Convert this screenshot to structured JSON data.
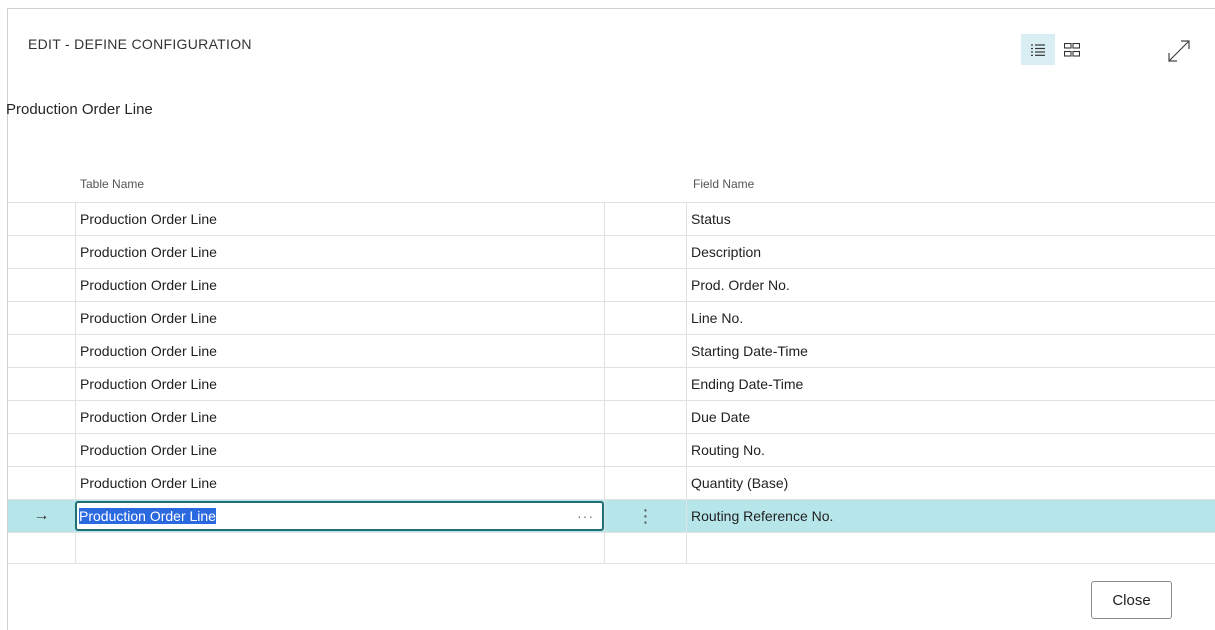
{
  "dialog": {
    "title": "EDIT - DEFINE CONFIGURATION",
    "subtitle": "Production Order Line",
    "close_label": "Close"
  },
  "toolbar": {
    "list_view_icon": "list-view-icon",
    "tile_view_icon": "tile-view-icon",
    "expand_icon": "expand-icon"
  },
  "table": {
    "columns": [
      "Table Name",
      "Field Name"
    ],
    "rows": [
      {
        "table_name": "Production Order Line",
        "field_name": "Status"
      },
      {
        "table_name": "Production Order Line",
        "field_name": "Description"
      },
      {
        "table_name": "Production Order Line",
        "field_name": "Prod. Order No."
      },
      {
        "table_name": "Production Order Line",
        "field_name": "Line No."
      },
      {
        "table_name": "Production Order Line",
        "field_name": "Starting Date-Time"
      },
      {
        "table_name": "Production Order Line",
        "field_name": "Ending Date-Time"
      },
      {
        "table_name": "Production Order Line",
        "field_name": "Due Date"
      },
      {
        "table_name": "Production Order Line",
        "field_name": "Routing No."
      },
      {
        "table_name": "Production Order Line",
        "field_name": "Quantity (Base)"
      },
      {
        "table_name": "Production Order Line",
        "field_name": "Routing Reference No."
      }
    ],
    "selected_row_index": 9,
    "row_indicator": "→",
    "lookup_dots": "···",
    "row_menu": "⋮"
  },
  "colors": {
    "accent": "#b6e6ea",
    "selection_highlight": "#2b69e0",
    "focus_border": "#1e6f78"
  }
}
